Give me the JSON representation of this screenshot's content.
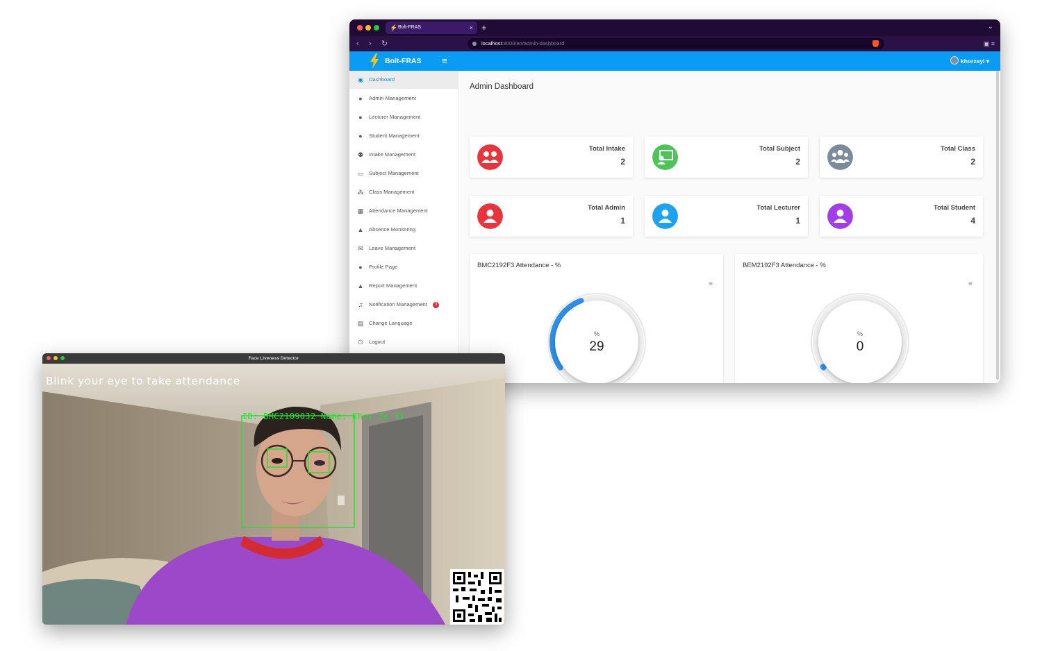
{
  "browser": {
    "tab_title": "Bolt-FRAS",
    "url_host": "localhost",
    "url_path": ":8000/en/admin-dashboard"
  },
  "appbar": {
    "brand": "Bolt-FRAS",
    "user": "khorzeyi"
  },
  "sidebar": {
    "items": [
      {
        "label": "Dashboard",
        "icon": "dashboard-icon"
      },
      {
        "label": "Admin Management",
        "icon": "user-icon"
      },
      {
        "label": "Lecturer Management",
        "icon": "user-icon"
      },
      {
        "label": "Student Management",
        "icon": "user-icon"
      },
      {
        "label": "Intake Management",
        "icon": "users-icon"
      },
      {
        "label": "Subject Management",
        "icon": "chalkboard-icon"
      },
      {
        "label": "Class Management",
        "icon": "group-icon"
      },
      {
        "label": "Attendance Management",
        "icon": "calendar-icon"
      },
      {
        "label": "Absence Monitoring",
        "icon": "warning-icon"
      },
      {
        "label": "Leave Management",
        "icon": "envelope-open-icon"
      },
      {
        "label": "Profile Page",
        "icon": "user-icon"
      },
      {
        "label": "Report Management",
        "icon": "warning-icon"
      },
      {
        "label": "Notification Management",
        "icon": "bell-icon",
        "badge": "3"
      },
      {
        "label": "Change Language",
        "icon": "language-icon"
      },
      {
        "label": "Logout",
        "icon": "power-icon"
      }
    ]
  },
  "dashboard": {
    "title": "Admin Dashboard",
    "cards": [
      {
        "label": "Total Intake",
        "value": "2",
        "color": "#e8343c",
        "icon": "users-icon"
      },
      {
        "label": "Total Subject",
        "value": "2",
        "color": "#4ec35a",
        "icon": "chalkboard-teacher-icon"
      },
      {
        "label": "Total Class",
        "value": "2",
        "color": "#7c8b9a",
        "icon": "group-icon"
      },
      {
        "label": "Total Admin",
        "value": "1",
        "color": "#e8343c",
        "icon": "user-icon"
      },
      {
        "label": "Total Lecturer",
        "value": "1",
        "color": "#1ea2f0",
        "icon": "user-icon"
      },
      {
        "label": "Total Student",
        "value": "4",
        "color": "#a13ee8",
        "icon": "user-icon"
      }
    ],
    "gauges": [
      {
        "title": "BMC2192F3 Attendance - %",
        "unit": "%",
        "value": "29",
        "percent": 29
      },
      {
        "title": "BEM2192F3 Attendance - %",
        "unit": "%",
        "value": "0",
        "percent": 0
      }
    ]
  },
  "camera": {
    "window_title": "Face Liveness Detector",
    "prompt": "Blink your eye to take attendance",
    "label": "ID: BMC2109032  Name: Khor Ze Yi"
  }
}
